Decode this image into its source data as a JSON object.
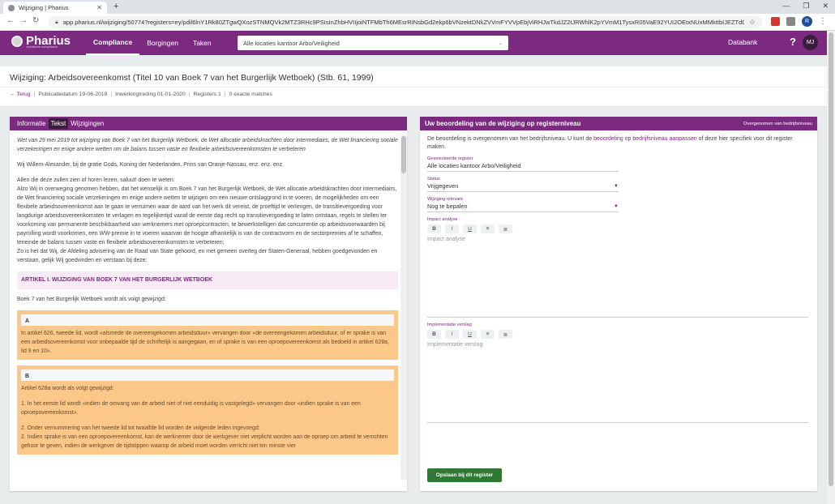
{
  "browser": {
    "tab_title": "Wijziging | Pharius",
    "url": "app.pharius.nl/wijziging/50774?registers=ey/pdil6lnY1Rk80ZTgwQXozSTNMQVk2MTZ3RHc9PSIsInZhbHVIIjoiNTFMbTh6MEsrRINsbGd2ekp6bVNzektDNkZVVmFYVVpEbjViRHJwTkdJZ2tJRWhlK2pYVmM1TysxR05VaE92YUI2OEtxNUxMMkttbIJEZTdGOFh5U1E9PSIsI...",
    "profile_initial": "R",
    "icons": {
      "back": "arrow-left-icon",
      "forward": "arrow-right-icon",
      "reload": "reload-icon",
      "lock": "lock-icon",
      "star": "star-icon"
    }
  },
  "app": {
    "logo": "Pharius",
    "logo_sub": "Juridische compliance",
    "nav": [
      "Compliance",
      "Borgingen",
      "Taken"
    ],
    "location_select": "Alle locaties kantoor Arbo/Veiligheid",
    "databank": "Databank",
    "help": "?",
    "avatar": "MJ",
    "accent": "#7b2a80"
  },
  "page": {
    "title": "Wijziging: Arbeidsovereenkomst (Titel 10 van Boek 7 van het Burgerlijk Wetboek) (Stb. 61, 1999)",
    "back": "Terug",
    "meta": [
      "Publicatiedatum 19-06-2019",
      "Inwerkingtreding 01-01-2020",
      "Registers 1",
      "0 exacte matches"
    ]
  },
  "left_card": {
    "tabs": [
      "Informatie",
      "Tekst",
      "Wijzigingen"
    ],
    "intro": "Wet van 29 mei 2019 tot wijziging van Boek 7 van het Burgerlijk Wetboek, de Wet allocatie arbeidskrachten door intermediairs, de Wet financiering sociale verzekeringen en enige andere wetten om de balans tussen vaste en flexibele arbeidsovereenkomsten te verbeteren",
    "p1": "Wij Willem-Alexander, bij de gratie Gods, Koning der Nederlanden, Prins van Oranje-Nassau, enz. enz. enz.",
    "p2_line1": "Allen die deze zullen zien of horen lezen, saluut! doen te weten:",
    "p2_line2": "Alzo Wij in overweging genomen hebben, dat het wenselijk is om Boek 7 van het Burgerlijk Wetboek, de Wet allocatie arbeidskrachten door intermediairs, de Wet financiering sociale verzekeringen en enige andere wetten te wijzigen om een nieuwe ontslaggrond in te voeren, de mogelijkheden om een flexibele arbeidsovereenkomst aan te gaan te verruimen waar de aard van het werk dit vereist, de proeftijd te verlengen, de transitievergoeding voor langdurige arbeidsovereenkomsten te verlagen en tegelijkertijd vanaf de eerste dag recht op transitievergoeding te laten ontstaan, regels te stellen ter voorkoming van permanente beschikbaarheid van werknemers met oproepcontracten, te bewerkstelligen dat concurrentie op arbeidsvoorwaarden bij payrolling wordt voorkomen, een WW-premie in te voeren waarvan de hoogte afhankelijk is van de contractvorm en de sectorpremies af te schaffen, teneinde de balans tussen vaste en flexibele arbeidsovereenkomsten te verbeteren;",
    "p2_line3": "Zo is het dat Wij, de Afdeling advisering van de Raad van State gehoord, en met gemeen overleg der Staten-Generaal, hebben goedgevonden en verstaan, gelijk Wij goedvinden en verstaan bij deze:",
    "article": "ARTIKEL I. WIJZIGING VAN BOEK 7 VAN HET BURGERLIJK WETBOEK",
    "article_intro": "Boek 7 van het Burgerlijk Wetboek wordt als volgt gewijzigd:",
    "block_a_label": "A",
    "block_a_text": "In artikel 626, tweede lid, wordt «alsmede de overeengekomen arbeidsduur» vervangen door «de overeengekomen arbeidsduur, of er sprake is van een arbeidsovereenkomst voor onbepaalde tijd de schriftelijk is aangegaan, en of sprake is van een oproepovereenkomst als bedoeld in artikel 628a, lid 9 en 10».",
    "block_b_label": "B",
    "block_b_p1": "Artikel 628a wordt als volgt gewijzigd:",
    "block_b_p2": "1. In het eerste lid wordt «indien de omvang van de arbeid niet of niet eenduidig is vastgelegd» vervangen door «indien sprake is van een oproepovereenkomst».",
    "block_b_p3": "2. Onder vernummering van het tweede lid tot twaalfde lid worden de volgende leden ingevoegd:",
    "block_b_p4": "2. Indien sprake is van een oproepovereenkomst, kan de werknemer door de werkgever niet verplicht worden aan de oproep om arbeid te verrichten gehoor te geven, indien de werkgever de tijdstippen waarop de arbeid moet worden verricht niet ten minste vier"
  },
  "right_card": {
    "title": "Uw beoordeling van de wijziging op registerniveau",
    "note": "Overgenomen van bedrijfsniveau",
    "intro_a": "De beoordeling is overgenomen van het bedrijfsniveau. U kunt de ",
    "intro_link": "beoordeling op bedrijfsniveau aanpassen",
    "intro_b": " of deze hier specifiek voor dit register maken.",
    "fields": [
      {
        "label": "Geselecteerde register",
        "value": "Alle locaties kantoor Arbo/Veiligheid"
      },
      {
        "label": "Status",
        "value": "Vrijgegeven"
      },
      {
        "label": "Wijziging relevant",
        "value": "Nog te bepalen"
      }
    ],
    "impact_label": "Impact analyse",
    "impact_placeholder": "Impact analyse",
    "impl_label": "Implementatie verslag",
    "impl_placeholder": "Implementatie verslag",
    "toolbar": [
      "B",
      "I",
      "U",
      "≡",
      "≣"
    ],
    "save": "Opslaan bij dit register"
  }
}
